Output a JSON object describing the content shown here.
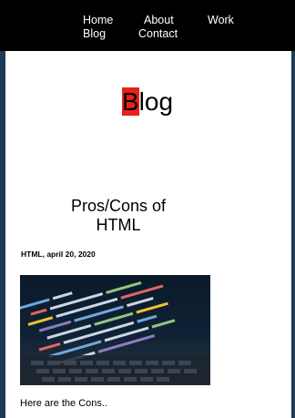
{
  "nav": {
    "home": "Home",
    "about": "About",
    "work": "Work",
    "blog": "Blog",
    "contact": "Contact"
  },
  "page_title": {
    "first_letter": "B",
    "rest": "log"
  },
  "post": {
    "title": "Pros/Cons of HTML",
    "meta": "HTML, april 20, 2020",
    "excerpt": "Here are the Cons.."
  },
  "colors": {
    "navbar": "#000000",
    "accent": "#e8201c",
    "edge": "#1f3b57"
  }
}
